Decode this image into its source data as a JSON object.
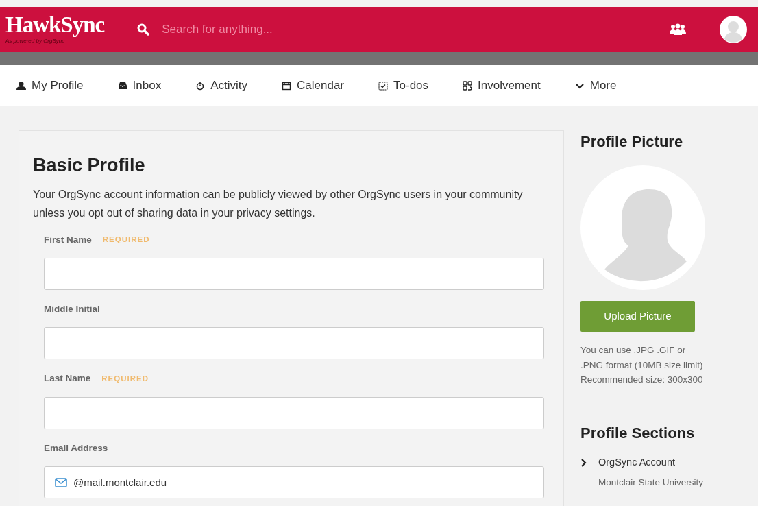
{
  "header": {
    "logo": "HawkSync",
    "tagline": "As powered by OrgSync",
    "search": {
      "placeholder": "Search for anything..."
    }
  },
  "nav": [
    {
      "label": "My Profile"
    },
    {
      "label": "Inbox"
    },
    {
      "label": "Activity"
    },
    {
      "label": "Calendar"
    },
    {
      "label": "To-dos"
    },
    {
      "label": "Involvement"
    },
    {
      "label": "More"
    }
  ],
  "basic_profile": {
    "title": "Basic Profile",
    "intro": "Your OrgSync account information can be publicly viewed by other OrgSync users in your community unless you opt out of sharing data in your privacy settings.",
    "fields": [
      {
        "kind": "text",
        "label": "First Name",
        "tag": "REQUIRED"
      },
      {
        "kind": "text",
        "label": "Middle Initial"
      },
      {
        "kind": "text",
        "label": "Last Name",
        "tag": "REQUIRED"
      },
      {
        "kind": "email",
        "label": "Email Address",
        "value": "@mail.montclair.edu"
      }
    ]
  },
  "profile_picture": {
    "title": "Profile Picture",
    "button": "Upload Picture",
    "help": [
      "You can use .JPG .GIF or .PNG format (10MB size limit)",
      "Recommended size: 300x300"
    ]
  },
  "profile_sections": {
    "title": "Profile Sections",
    "items": [
      {
        "label": "OrgSync Account",
        "sub": "Montclair State University"
      }
    ]
  }
}
